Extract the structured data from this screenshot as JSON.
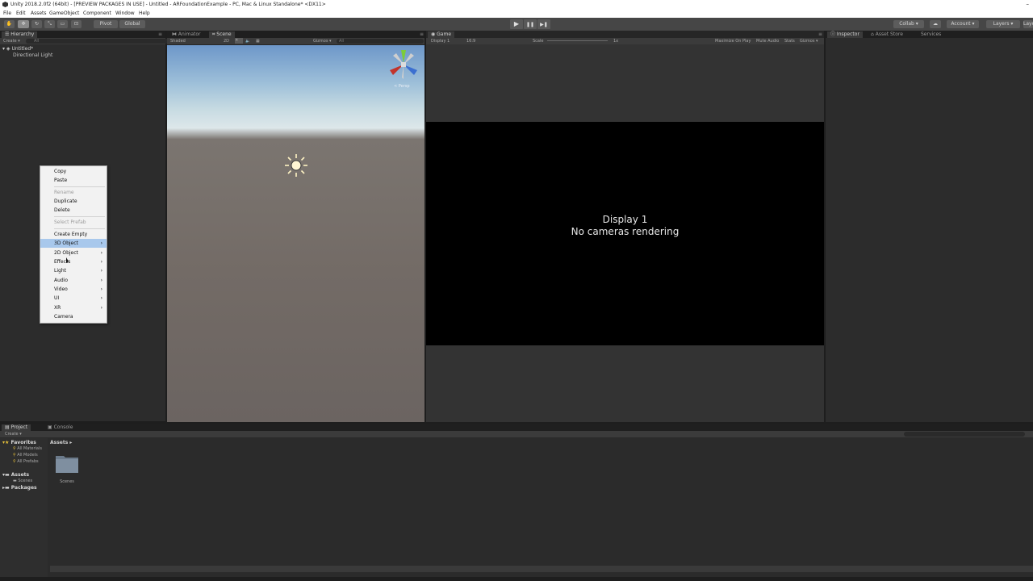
{
  "window": {
    "title": "Unity 2018.2.0f2 (64bit) - [PREVIEW PACKAGES IN USE] - Untitled - ARFoundationExample - PC, Mac & Linux Standalone* <DX11>",
    "minimize_glyph": "–"
  },
  "menubar": [
    "File",
    "Edit",
    "Assets",
    "GameObject",
    "Component",
    "Window",
    "Help"
  ],
  "toolbar": {
    "pivot_label": "Pivot",
    "global_label": "Global",
    "play_glyph": "▶",
    "pause_glyph": "❚❚",
    "step_glyph": "▶❚",
    "collab_label": "Collab ▾",
    "account_label": "Account ▾",
    "layers_label": "Layers ▾",
    "layout_label": "Layout ▾"
  },
  "hierarchy": {
    "tab": "Hierarchy",
    "create_label": "Create ▾",
    "search_placeholder": "All",
    "scene_name": "Untitled*",
    "items": [
      "Directional Light"
    ]
  },
  "context_menu": {
    "items": [
      {
        "label": "Copy"
      },
      {
        "label": "Paste"
      },
      {
        "label": "Rename"
      },
      {
        "label": "Duplicate"
      },
      {
        "label": "Delete"
      },
      {
        "label": "Select Prefab"
      },
      {
        "label": "Create Empty"
      },
      {
        "label": "3D Object"
      },
      {
        "label": "2D Object"
      },
      {
        "label": "Effects"
      },
      {
        "label": "Light"
      },
      {
        "label": "Audio"
      },
      {
        "label": "Video"
      },
      {
        "label": "UI"
      },
      {
        "label": "XR"
      },
      {
        "label": "Camera"
      }
    ],
    "arrow_glyph": "›"
  },
  "scene_view": {
    "tabs": [
      "Animator",
      "Scene"
    ],
    "shading_label": "Shaded",
    "mode_2d": "2D",
    "gizmos_label": "Gizmos ▾",
    "search_placeholder": "All",
    "persp_label": "< Persp"
  },
  "game_view": {
    "tab": "Game",
    "display_label": "Display 1",
    "aspect_label": "16:9",
    "scale_label": "Scale",
    "scale_value": "1x",
    "maximize_label": "Maximize On Play",
    "mute_label": "Mute Audio",
    "stats_label": "Stats",
    "gizmos_label": "Gizmos ▾",
    "message_line1": "Display 1",
    "message_line2": "No cameras rendering"
  },
  "inspector": {
    "tabs": [
      "Inspector",
      "Asset Store",
      "Services"
    ]
  },
  "project": {
    "tabs": [
      "Project",
      "Console"
    ],
    "create_label": "Create ▾",
    "tree": {
      "favorites_label": "Favorites",
      "favorites": [
        "All Materials",
        "All Models",
        "All Prefabs"
      ],
      "assets_label": "Assets",
      "assets_children": [
        "Scenes"
      ],
      "packages_label": "Packages"
    },
    "breadcrumb": "Assets ▸",
    "folders": [
      "Scenes"
    ]
  },
  "colors": {
    "accent_highlight": "#a8c8ec",
    "panel_bg": "#2c2c2c",
    "toolbar_bg": "#464646",
    "game_bg": "#000000"
  }
}
